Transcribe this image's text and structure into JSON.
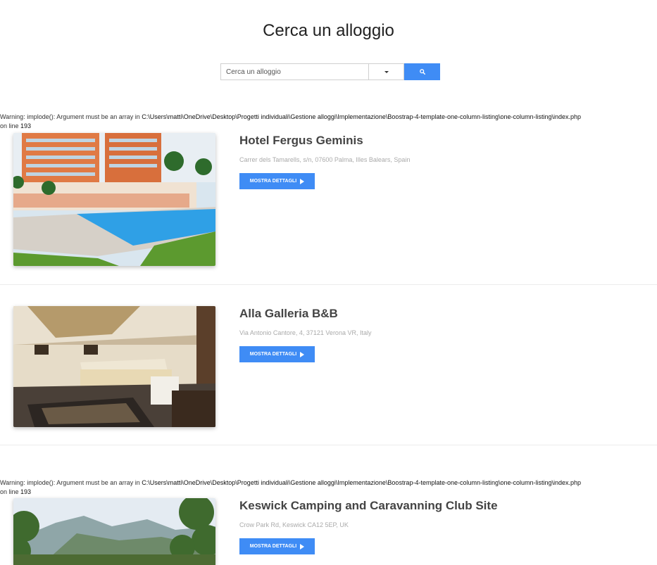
{
  "header": {
    "title": "Cerca un alloggio"
  },
  "search": {
    "placeholder": "Cerca un alloggio"
  },
  "warning": {
    "label": "Warning",
    "message": ": implode(): Argument must be an array in ",
    "path": "C:\\Users\\matti\\OneDrive\\Desktop\\Progetti individuali\\Gestione alloggi\\Implementazione\\Boostrap-4-template-one-column-listing\\one-column-listing\\index.php",
    "line_text": "on line ",
    "line_number": "193"
  },
  "listings": [
    {
      "title": "Hotel Fergus Geminis",
      "address": "Carrer dels Tamarells, s/n, 07600 Palma, Illes Balears, Spain",
      "button_label": "MOSTRA DETTAGLI"
    },
    {
      "title": "Alla Galleria B&B",
      "address": "Via Antonio Cantore, 4, 37121 Verona VR, Italy",
      "button_label": "MOSTRA DETTAGLI"
    },
    {
      "title": "Keswick Camping and Caravanning Club Site",
      "address": "Crow Park Rd, Keswick CA12 5EP, UK",
      "button_label": "MOSTRA DETTAGLI"
    }
  ],
  "colors": {
    "accent": "#3f8cf5"
  }
}
